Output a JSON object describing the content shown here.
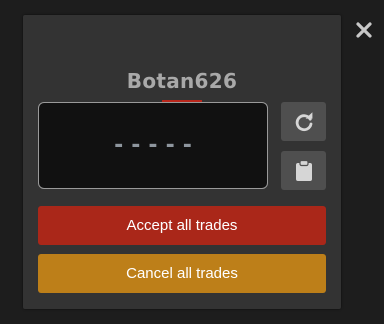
{
  "dialog": {
    "title": "Botan626",
    "code_value": "-----",
    "accept_label": "Accept all trades",
    "cancel_label": "Cancel all trades"
  },
  "icons": {
    "close": "close-icon",
    "refresh": "refresh-icon",
    "clipboard": "clipboard-icon"
  },
  "colors": {
    "background": "#1d1d1d",
    "panel": "#333333",
    "accent_red": "#aa2719",
    "accent_orange": "#bd7f19",
    "title": "#a9a9a9"
  }
}
